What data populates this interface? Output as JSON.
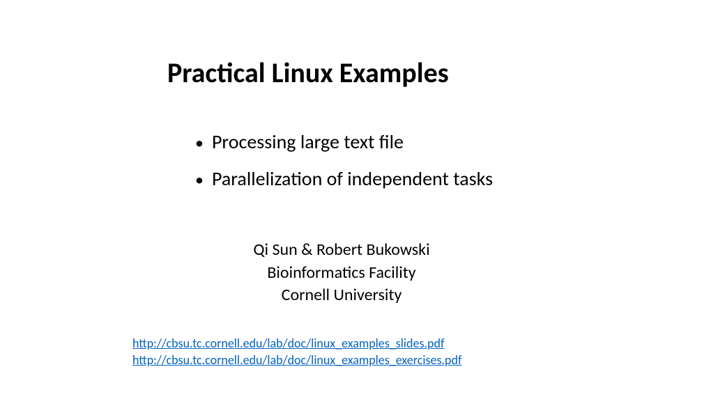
{
  "title": "Practical Linux Examples",
  "bullets": [
    "Processing large text file",
    "Parallelization of independent tasks"
  ],
  "authors": {
    "line1": "Qi Sun & Robert Bukowski",
    "line2": "Bioinformatics Facility",
    "line3": "Cornell University"
  },
  "links": {
    "slides": "http://cbsu.tc.cornell.edu/lab/doc/linux_examples_slides.pdf",
    "exercises": "http://cbsu.tc.cornell.edu/lab/doc/linux_examples_exercises.pdf"
  }
}
